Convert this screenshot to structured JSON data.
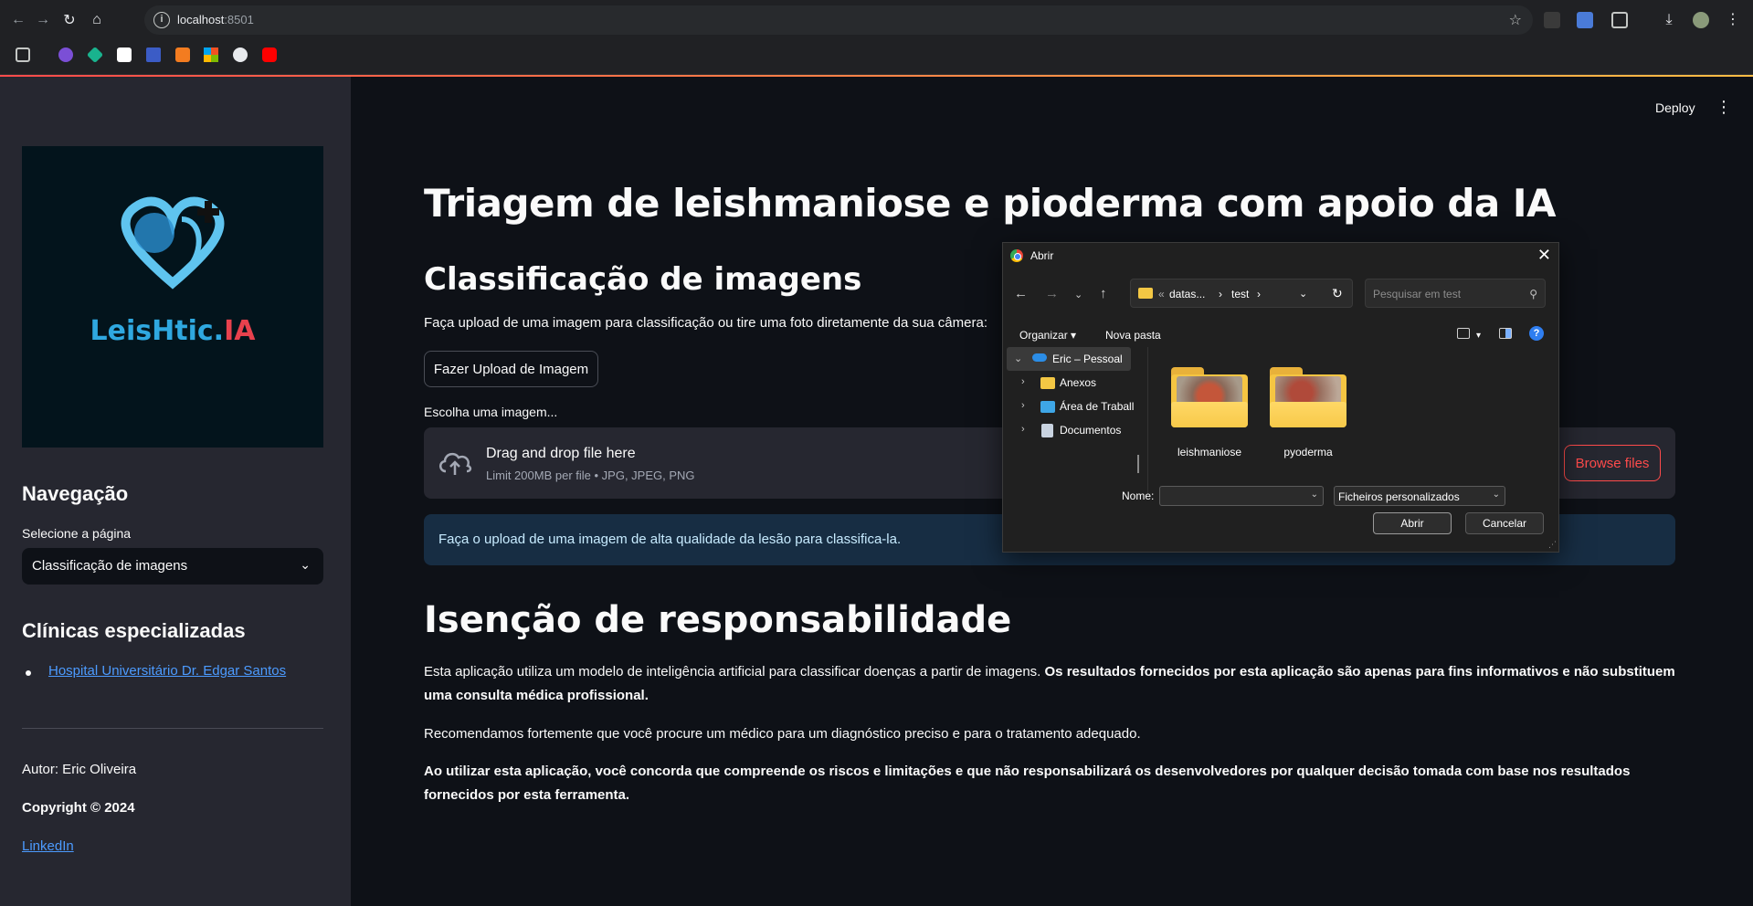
{
  "browser": {
    "url_host": "localhost",
    "url_port": ":8501"
  },
  "sidebar": {
    "logo": {
      "text_main": "LeisHtic.",
      "text_accent": "IA"
    },
    "nav_heading": "Navegação",
    "select_label": "Selecione a página",
    "select_value": "Classificação de imagens",
    "clinics_heading": "Clínicas especializadas",
    "clinic_link": "Hospital Universitário Dr. Edgar Santos",
    "author": "Autor: Eric Oliveira",
    "copyright": "Copyright © 2024",
    "linkedin": "LinkedIn"
  },
  "header": {
    "deploy_label": "Deploy",
    "menu_glyph": "⋮"
  },
  "main": {
    "title": "Triagem de leishmaniose e pioderma com apoio da IA",
    "section_title": "Classificação de imagens",
    "intro": "Faça upload de uma imagem para classificação ou tire uma foto diretamente da sua câmera:",
    "upload_button": "Fazer Upload de Imagem",
    "uploader_label": "Escolha uma imagem...",
    "dropzone_title": "Drag and drop file here",
    "dropzone_sub": "Limit 200MB per file • JPG, JPEG, PNG",
    "browse_button": "Browse files",
    "info_message": "Faça o upload de uma imagem de alta qualidade da lesão para classifica-la.",
    "disclaimer_title": "Isenção de responsabilidade",
    "disclaimer_p1_normal": "Esta aplicação utiliza um modelo de inteligência artificial para classificar doenças a partir de imagens. ",
    "disclaimer_p1_bold": "Os resultados fornecidos por esta aplicação são apenas para fins informativos e não substituem uma consulta médica profissional.",
    "disclaimer_p2": "Recomendamos fortemente que você procure um médico para um diagnóstico preciso e para o tratamento adequado.",
    "disclaimer_p3": "Ao utilizar esta aplicação, você concorda que compreende os riscos e limitações e que não responsabilizará os desenvolvedores por qualquer decisão tomada com base nos resultados fornecidos por esta ferramenta."
  },
  "dialog": {
    "title": "Abrir",
    "path_prefix": "«",
    "path_segment_1": "datas...",
    "path_sep": "›",
    "path_segment_2": "test",
    "search_placeholder": "Pesquisar em test",
    "organize_label": "Organizar ▾",
    "new_folder_label": "Nova pasta",
    "tree": [
      {
        "label": "Eric – Pessoal"
      },
      {
        "label": "Anexos"
      },
      {
        "label": "Área de Traball"
      },
      {
        "label": "Documentos"
      }
    ],
    "folders": [
      {
        "label": "leishmaniose"
      },
      {
        "label": "pyoderma"
      }
    ],
    "name_label": "Nome:",
    "name_value": "",
    "filter_value": "Ficheiros personalizados",
    "open_button": "Abrir",
    "cancel_button": "Cancelar"
  },
  "colors": {
    "accent": "#ff4b4b",
    "info_bg": "#172d43",
    "sidebar_bg": "#262730",
    "main_bg": "#0e1117"
  }
}
